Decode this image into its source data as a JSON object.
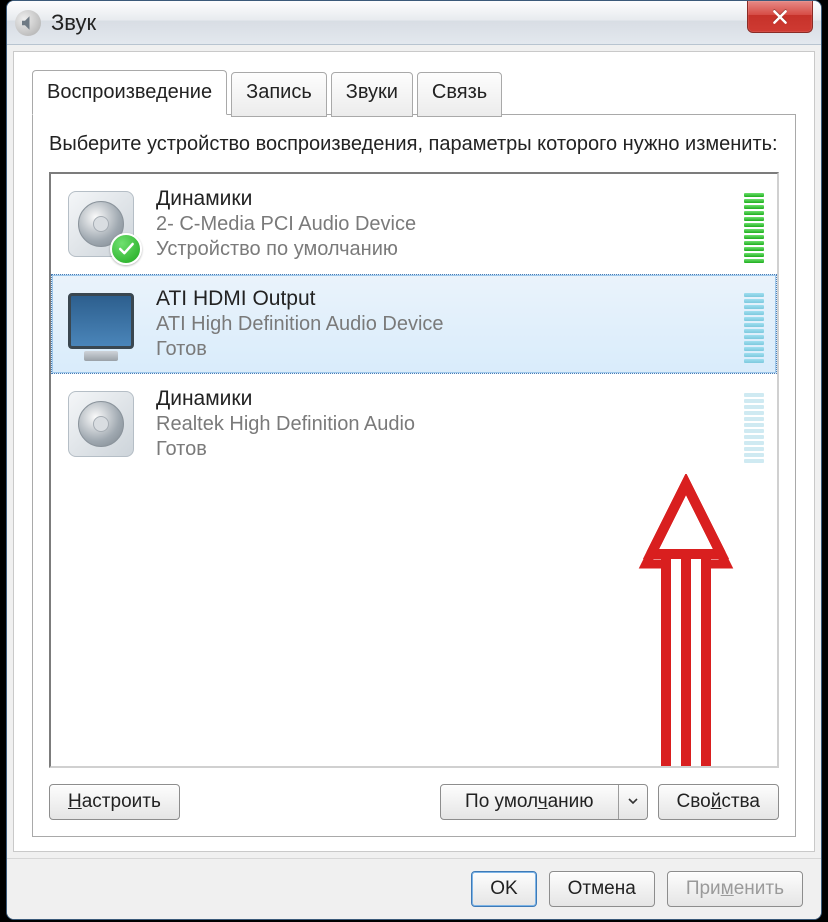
{
  "title": "Звук",
  "tabs": [
    {
      "label": "Воспроизведение",
      "active": true
    },
    {
      "label": "Запись",
      "active": false
    },
    {
      "label": "Звуки",
      "active": false
    },
    {
      "label": "Связь",
      "active": false
    }
  ],
  "instruction": "Выберите устройство воспроизведения, параметры которого нужно изменить:",
  "devices": [
    {
      "title": "Динамики",
      "sub": "2- C-Media PCI Audio Device",
      "status": "Устройство по умолчанию",
      "icon": "speaker",
      "default": true,
      "selected": false,
      "meter": "green"
    },
    {
      "title": "ATI HDMI Output",
      "sub": "ATI High Definition Audio Device",
      "status": "Готов",
      "icon": "monitor",
      "default": false,
      "selected": true,
      "meter": "cyan"
    },
    {
      "title": "Динамики",
      "sub": "Realtek High Definition Audio",
      "status": "Готов",
      "icon": "speaker",
      "default": false,
      "selected": false,
      "meter": "dim"
    }
  ],
  "panel_buttons": {
    "configure": "Настроить",
    "set_default": "По умолчанию",
    "properties": "Свойства"
  },
  "dialog_buttons": {
    "ok": "OK",
    "cancel": "Отмена",
    "apply": "Применить"
  },
  "annotation": {
    "type": "arrow",
    "color": "#d91f1f"
  }
}
